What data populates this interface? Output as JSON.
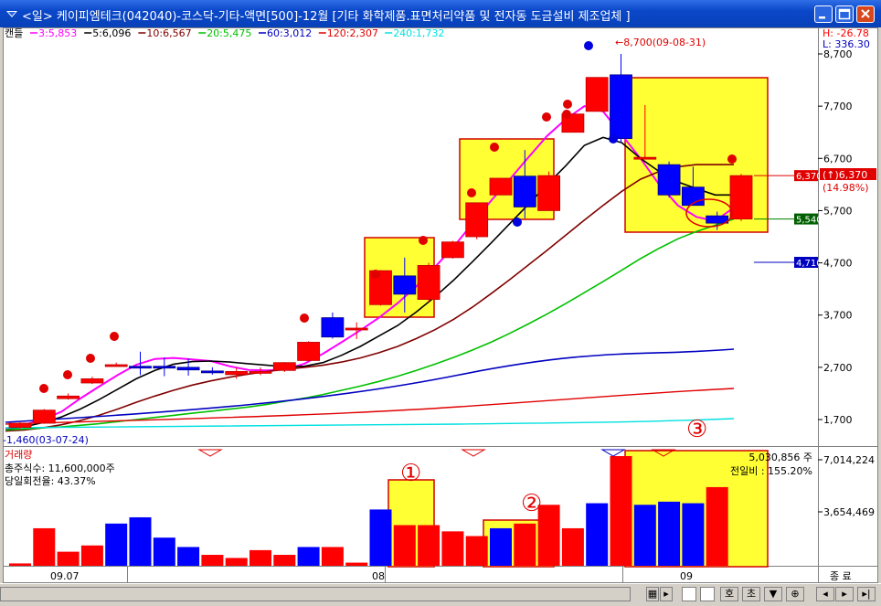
{
  "window": {
    "title": "<일> 케이피엠테크(042040)-코스닥-기타-액면[500]-12월 [기타 화학제품.표면처리약품 및 전자동 도금설비 제조업체 ]"
  },
  "legend": {
    "candle_label": "캔들",
    "items": [
      {
        "text": "3:5,853",
        "color": "#ff00ff"
      },
      {
        "text": "5:6,096",
        "color": "#000000"
      },
      {
        "text": "10:6,567",
        "color": "#800000"
      },
      {
        "text": "20:5,475",
        "color": "#00c000"
      },
      {
        "text": "60:3,012",
        "color": "#0000c0"
      },
      {
        "text": "120:2,307",
        "color": "#e00000"
      },
      {
        "text": "240:1,732",
        "color": "#00e0e0"
      }
    ]
  },
  "hl": {
    "high": "H: -26.78",
    "low": "L: 336.30"
  },
  "price_axis": {
    "ticks": [
      {
        "label": "8,700",
        "value": 8700
      },
      {
        "label": "7,700",
        "value": 7700
      },
      {
        "label": "6,700",
        "value": 6700
      },
      {
        "label": "5,700",
        "value": 5700
      },
      {
        "label": "4,700",
        "value": 4700
      },
      {
        "label": "3,700",
        "value": 3700
      },
      {
        "label": "2,700",
        "value": 2700
      },
      {
        "label": "1,700",
        "value": 1700
      }
    ],
    "ref_lines": [
      {
        "label": "6,370",
        "value": 6370,
        "color": "#e00000",
        "box": "#e00000"
      },
      {
        "label": "5,540",
        "value": 5540,
        "color": "#008000",
        "box": "#006000"
      },
      {
        "label": "4,710",
        "value": 4710,
        "color": "#0000c0",
        "box": "#0000c0"
      }
    ],
    "current_label": "(↑)6,370",
    "change_label": "(14.98%)"
  },
  "annotations": {
    "high_note": "←8,700(09-08-31)",
    "low_note": "-1,460(03-07-24)",
    "circle_1": "①",
    "circle_2": "②",
    "circle_3": "③"
  },
  "volume_panel": {
    "title": "거래량",
    "shares_label": "총주식수:  11,600,000주",
    "turnover_label": "당일회전율:   43.37%",
    "current_volume": "5,030,856 주",
    "prev_ratio": "전일비 : 155.20%",
    "ticks": [
      {
        "label": "7,014,224",
        "value": 7014224
      },
      {
        "label": "3,654,469",
        "value": 3654469
      }
    ]
  },
  "date_axis": {
    "labels": [
      "09.07",
      "08",
      "09"
    ],
    "end_label": "종 료"
  },
  "statusbar": {
    "btn_ho": "호",
    "btn_cho": "초"
  },
  "colors": {
    "up": "#ff0000",
    "down": "#0000ff",
    "box_fill": "#ffff33",
    "box_stroke": "#d00000"
  },
  "chart_data": {
    "type": "candlestick",
    "price_range": [
      1460,
      8700
    ],
    "candles": [
      {
        "o": 1550,
        "h": 1650,
        "l": 1520,
        "c": 1630
      },
      {
        "o": 1630,
        "h": 1900,
        "l": 1620,
        "c": 1880
      },
      {
        "o": 2100,
        "h": 2200,
        "l": 2080,
        "c": 2150
      },
      {
        "o": 2400,
        "h": 2520,
        "l": 2380,
        "c": 2480
      },
      {
        "o": 2740,
        "h": 2790,
        "l": 2720,
        "c": 2750
      },
      {
        "o": 2720,
        "h": 3000,
        "l": 2550,
        "c": 2700
      },
      {
        "o": 2720,
        "h": 2890,
        "l": 2530,
        "c": 2700
      },
      {
        "o": 2700,
        "h": 2870,
        "l": 2540,
        "c": 2650
      },
      {
        "o": 2630,
        "h": 2700,
        "l": 2560,
        "c": 2620
      },
      {
        "o": 2560,
        "h": 2700,
        "l": 2480,
        "c": 2620
      },
      {
        "o": 2590,
        "h": 2700,
        "l": 2550,
        "c": 2620
      },
      {
        "o": 2640,
        "h": 2800,
        "l": 2610,
        "c": 2790
      },
      {
        "o": 2830,
        "h": 3200,
        "l": 2820,
        "c": 3180
      },
      {
        "o": 3650,
        "h": 3750,
        "l": 3250,
        "c": 3280
      },
      {
        "o": 3420,
        "h": 3560,
        "l": 3240,
        "c": 3450
      },
      {
        "o": 3900,
        "h": 4560,
        "l": 3880,
        "c": 4550
      },
      {
        "o": 4450,
        "h": 4800,
        "l": 3750,
        "c": 4100
      },
      {
        "o": 4000,
        "h": 4700,
        "l": 3950,
        "c": 4650
      },
      {
        "o": 4800,
        "h": 5120,
        "l": 4780,
        "c": 5100
      },
      {
        "o": 5200,
        "h": 5850,
        "l": 5150,
        "c": 5850
      },
      {
        "o": 6000,
        "h": 6150,
        "l": 6000,
        "c": 6320
      },
      {
        "o": 6360,
        "h": 6860,
        "l": 5550,
        "c": 5770
      },
      {
        "o": 5700,
        "h": 6450,
        "l": 5700,
        "c": 6370
      },
      {
        "o": 7200,
        "h": 7550,
        "l": 7200,
        "c": 7550
      },
      {
        "o": 7600,
        "h": 8250,
        "l": 7600,
        "c": 8250
      },
      {
        "o": 8300,
        "h": 8700,
        "l": 7000,
        "c": 7080
      },
      {
        "o": 6720,
        "h": 7720,
        "l": 6700,
        "c": 6720
      },
      {
        "o": 6580,
        "h": 6640,
        "l": 5950,
        "c": 6000
      },
      {
        "o": 6150,
        "h": 6540,
        "l": 5800,
        "c": 5800
      },
      {
        "o": 5600,
        "h": 5680,
        "l": 5330,
        "c": 5460
      },
      {
        "o": 5540,
        "h": 6400,
        "l": 5500,
        "c": 6370
      }
    ],
    "volumes": [
      150000,
      2400000,
      900000,
      1300000,
      2700000,
      3100000,
      1800000,
      1200000,
      700000,
      500000,
      1000000,
      700000,
      1200000,
      1200000,
      200000,
      3600000,
      2600000,
      2600000,
      2200000,
      1900000,
      2400000,
      2700000,
      3900000,
      2400000,
      4000000,
      7014224,
      3900000,
      4100000,
      4000000,
      5030856
    ],
    "ma_series": [
      {
        "name": "3",
        "values": [
          1520,
          1600,
          1700,
          1850,
          2100,
          2330,
          2550,
          2750,
          2860,
          2880,
          2850,
          2820,
          2720,
          2650,
          2640,
          2660,
          2770,
          2960,
          3180,
          3410,
          3650,
          3930,
          4250,
          4620,
          5010,
          5450,
          5890,
          6300,
          6720,
          7130,
          7450,
          7700,
          7600,
          7150,
          6700,
          6200,
          5800,
          5580,
          5500,
          5760
        ]
      },
      {
        "name": "5",
        "values": [
          1500,
          1560,
          1640,
          1750,
          1900,
          2080,
          2280,
          2480,
          2640,
          2760,
          2810,
          2820,
          2800,
          2770,
          2740,
          2710,
          2720,
          2790,
          2930,
          3100,
          3300,
          3500,
          3760,
          4050,
          4370,
          4720,
          5080,
          5450,
          5820,
          6200,
          6560,
          6950,
          7100,
          7000,
          6700,
          6450,
          6250,
          6120,
          6000,
          6000
        ]
      },
      {
        "name": "10",
        "values": [
          1480,
          1500,
          1540,
          1600,
          1680,
          1780,
          1900,
          2030,
          2150,
          2260,
          2360,
          2440,
          2510,
          2570,
          2620,
          2660,
          2700,
          2740,
          2800,
          2880,
          2980,
          3100,
          3250,
          3420,
          3620,
          3850,
          4110,
          4380,
          4660,
          4940,
          5230,
          5520,
          5800,
          6070,
          6300,
          6450,
          6540,
          6580,
          6580,
          6580
        ]
      },
      {
        "name": "20",
        "values": [
          1500,
          1520,
          1540,
          1560,
          1590,
          1620,
          1660,
          1700,
          1740,
          1780,
          1820,
          1860,
          1900,
          1940,
          1990,
          2050,
          2110,
          2180,
          2260,
          2340,
          2430,
          2530,
          2640,
          2760,
          2890,
          3030,
          3180,
          3350,
          3530,
          3720,
          3920,
          4130,
          4340,
          4560,
          4780,
          4980,
          5160,
          5300,
          5420,
          5540
        ]
      }
    ]
  }
}
